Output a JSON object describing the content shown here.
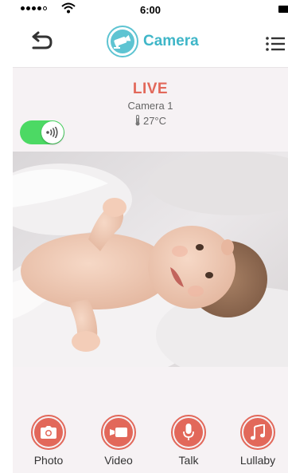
{
  "status_bar": {
    "time": "6:00"
  },
  "nav": {
    "title": "Camera"
  },
  "info": {
    "status": "LIVE",
    "camera_name": "Camera 1",
    "temperature": "27°C",
    "audio_toggle_on": true
  },
  "controls": [
    {
      "label": "Photo",
      "icon": "camera-icon"
    },
    {
      "label": "Video",
      "icon": "video-camera-icon"
    },
    {
      "label": "Talk",
      "icon": "microphone-icon"
    },
    {
      "label": "Lullaby",
      "icon": "music-note-icon"
    }
  ],
  "colors": {
    "accent_teal": "#5ec4d2",
    "accent_coral": "#e2685a",
    "toggle_green": "#4cd964",
    "background": "#f6f2f4"
  }
}
